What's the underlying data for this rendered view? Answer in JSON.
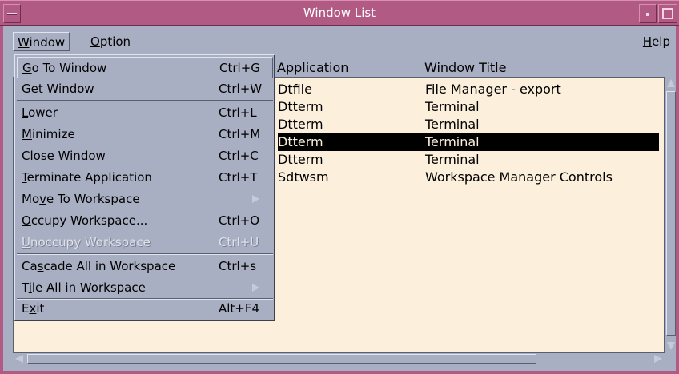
{
  "window": {
    "title": "Window List"
  },
  "menubar": {
    "window": {
      "label": "Window",
      "mnemonic": "W",
      "rest": "indow"
    },
    "option": {
      "label": "Option",
      "mnemonic": "O",
      "rest": "ption"
    },
    "help": {
      "label": "Help",
      "pre": "",
      "mnemonic": "H",
      "rest": "elp"
    }
  },
  "columns": {
    "application": "Application",
    "window_title": "Window Title"
  },
  "rows": [
    {
      "app": "Dtfile",
      "title": "File Manager - export"
    },
    {
      "app": "Dtterm",
      "title": "Terminal"
    },
    {
      "app": "Dtterm",
      "title": "Terminal"
    },
    {
      "app": "Dtterm",
      "title": "Terminal",
      "selected": true
    },
    {
      "app": "Dtterm",
      "title": "Terminal"
    },
    {
      "app": "Sdtwsm",
      "title": "Workspace Manager Controls"
    }
  ],
  "dropdown": {
    "items": [
      {
        "pre": "",
        "mn": "G",
        "post": "o To Window",
        "accel": "Ctrl+G",
        "active": true
      },
      {
        "pre": "Get ",
        "mn": "W",
        "post": "indow",
        "accel": "Ctrl+W"
      },
      {
        "pre": "",
        "mn": "L",
        "post": "ower",
        "accel": "Ctrl+L"
      },
      {
        "pre": "",
        "mn": "M",
        "post": "inimize",
        "accel": "Ctrl+M"
      },
      {
        "pre": "",
        "mn": "C",
        "post": "lose Window",
        "accel": "Ctrl+C"
      },
      {
        "pre": "",
        "mn": "T",
        "post": "erminate Application",
        "accel": "Ctrl+T"
      },
      {
        "pre": "Mo",
        "mn": "v",
        "post": "e To Workspace",
        "accel": ""
      },
      {
        "pre": "",
        "mn": "O",
        "post": "ccupy Workspace...",
        "accel": "Ctrl+O"
      },
      {
        "pre": "",
        "mn": "U",
        "post": "noccupy Workspace",
        "accel": "Ctrl+U",
        "disabled": true
      },
      {
        "pre": "Ca",
        "mn": "s",
        "post": "cade All in Workspace",
        "accel": "Ctrl+s"
      },
      {
        "pre": "T",
        "mn": "i",
        "post": "le All in Workspace",
        "accel": ""
      },
      {
        "pre": "E",
        "mn": "x",
        "post": "it",
        "accel": "Alt+F4"
      }
    ]
  },
  "colors": {
    "titlebar": "#b15a84",
    "background": "#a9afc2",
    "list_bg": "#fcf0dc",
    "selection": "#000000"
  }
}
